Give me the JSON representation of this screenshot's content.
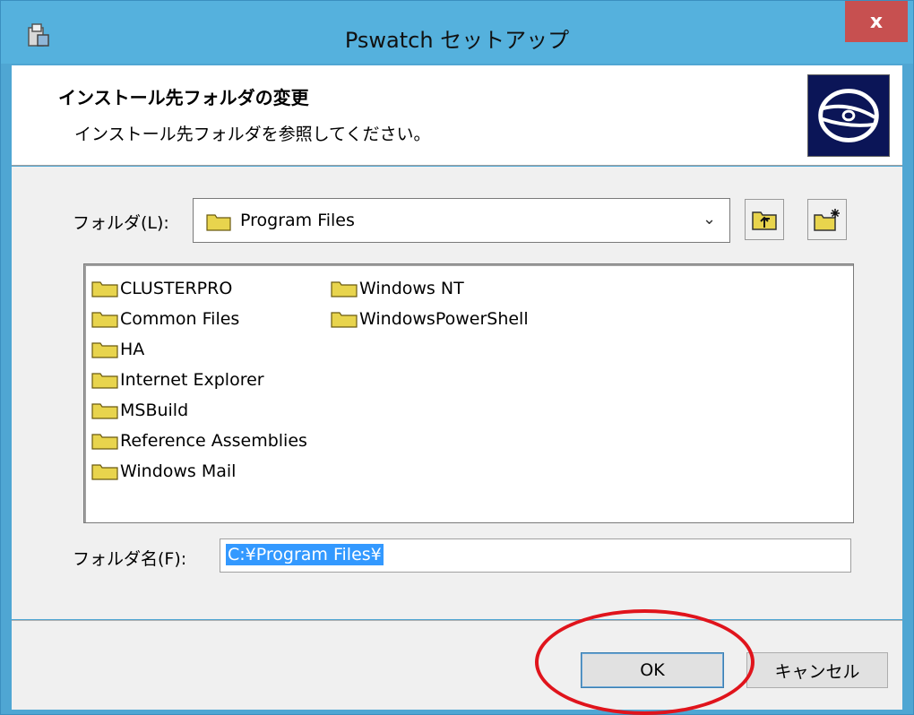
{
  "window": {
    "title": "Pswatch セットアップ",
    "close_label": "x"
  },
  "header": {
    "title": "インストール先フォルダの変更",
    "subtitle": "インストール先フォルダを参照してください。"
  },
  "folder_select": {
    "label": "フォルダ(L):",
    "value": "Program Files"
  },
  "folder_list": {
    "column1": [
      "CLUSTERPRO",
      "Common Files",
      "HA",
      "Internet Explorer",
      "MSBuild",
      "Reference Assemblies",
      "Windows Mail"
    ],
    "column2": [
      "Windows NT",
      "WindowsPowerShell"
    ]
  },
  "folder_name": {
    "label": "フォルダ名(F):",
    "value": "C:¥Program Files¥"
  },
  "buttons": {
    "ok": "OK",
    "cancel": "キャンセル"
  },
  "icons": {
    "folder": "folder-icon",
    "up": "folder-up-icon",
    "new_folder": "new-folder-icon",
    "disc": "disc-icon",
    "app": "setup-icon",
    "dropdown": "chevron-down-icon"
  },
  "colors": {
    "titlebar": "#55b1dd",
    "close": "#c75050",
    "selection": "#3399ff",
    "annotation": "#e0141c",
    "folder": "#e8d44d"
  }
}
